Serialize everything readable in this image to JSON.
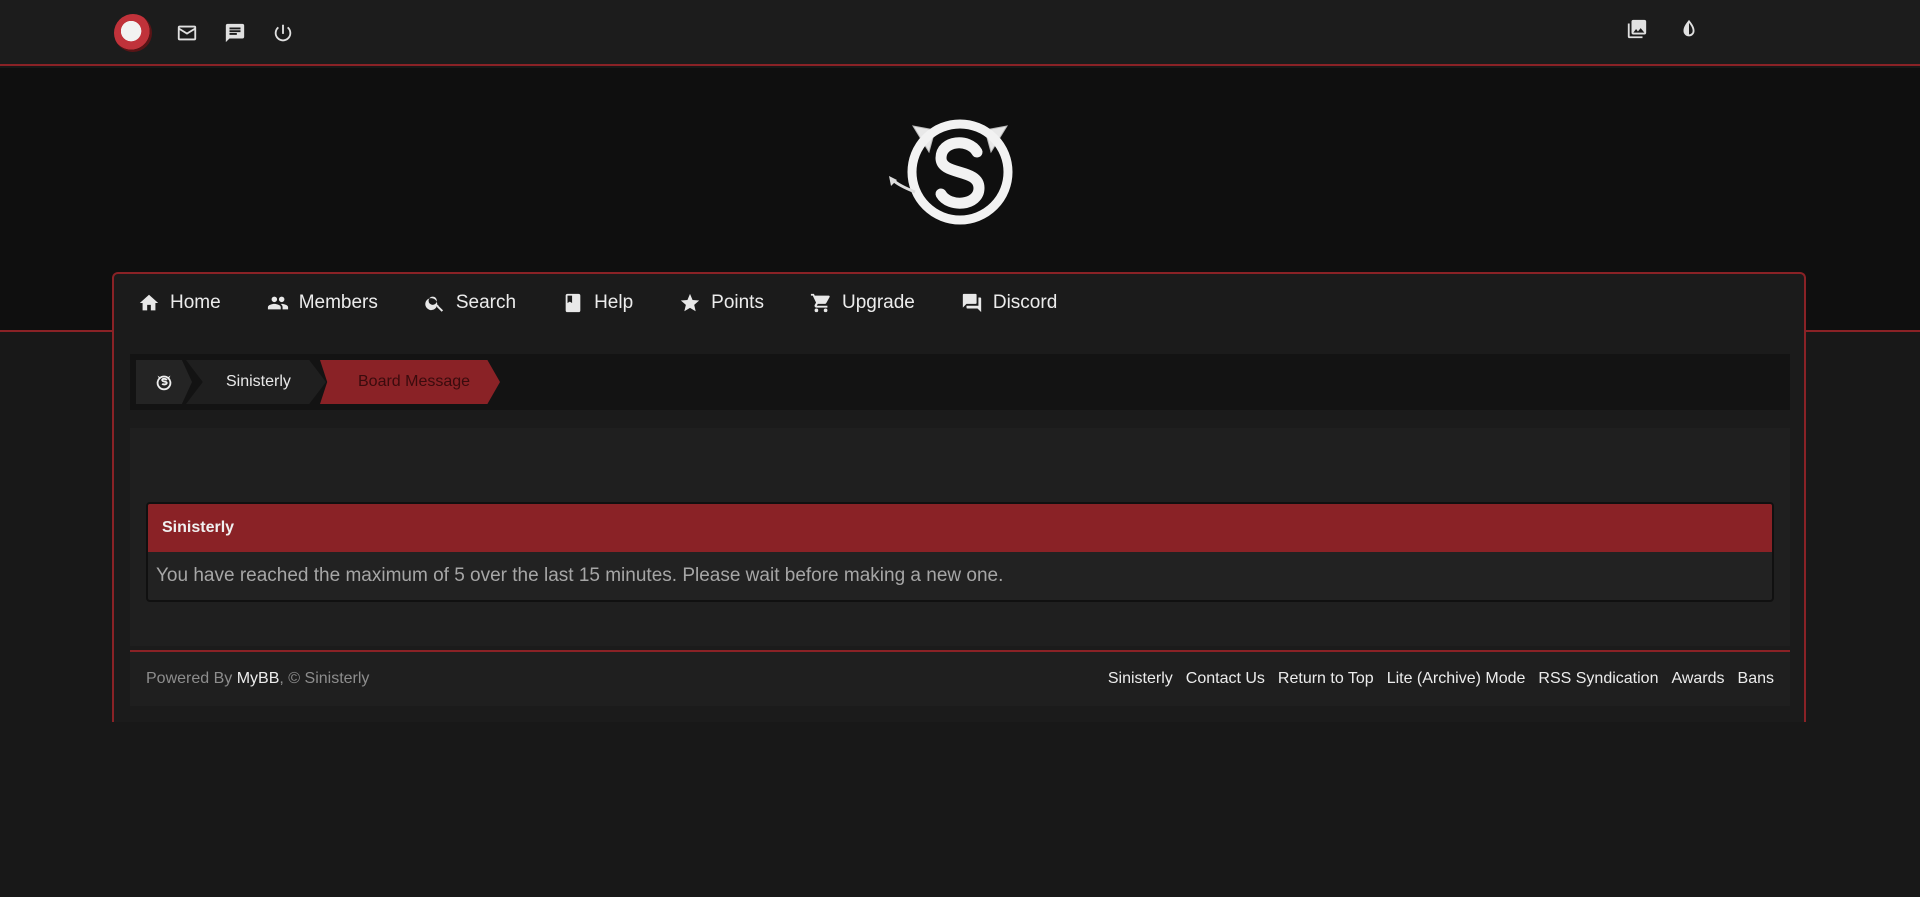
{
  "topbar": {
    "left_icons": [
      "avatar",
      "mail-icon",
      "chat-icon",
      "power-icon"
    ],
    "right_icons": [
      "gallery-icon",
      "contrast-icon"
    ]
  },
  "nav": {
    "items": [
      {
        "label": "Home",
        "icon": "home-icon"
      },
      {
        "label": "Members",
        "icon": "members-icon"
      },
      {
        "label": "Search",
        "icon": "search-icon"
      },
      {
        "label": "Help",
        "icon": "help-book-icon"
      },
      {
        "label": "Points",
        "icon": "star-icon"
      },
      {
        "label": "Upgrade",
        "icon": "cart-icon"
      },
      {
        "label": "Discord",
        "icon": "discord-chat-icon"
      }
    ]
  },
  "breadcrumb": {
    "site": "Sinisterly",
    "current": "Board Message"
  },
  "message": {
    "title": "Sinisterly",
    "body": "You have reached the maximum of 5 over the last 15 minutes. Please wait before making a new one."
  },
  "footer": {
    "powered_prefix": "Powered By ",
    "powered_link": "MyBB",
    "powered_suffix": ", © Sinisterly",
    "links": [
      "Sinisterly",
      "Contact Us",
      "Return to Top",
      "Lite (Archive) Mode",
      "RSS Syndication",
      "Awards",
      "Bans"
    ]
  },
  "colors": {
    "accent": "#8a2226",
    "background": "#181818",
    "header": "#0f0f0f"
  }
}
